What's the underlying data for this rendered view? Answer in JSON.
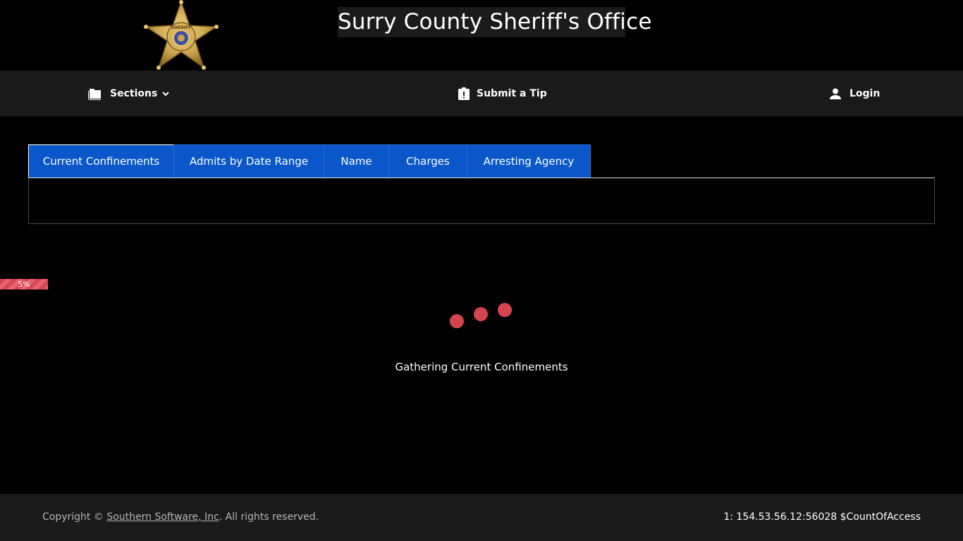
{
  "header": {
    "title": "Surry County Sheriff's Office",
    "badge_text": "SHERIFF",
    "badge_color": "#c9a14a"
  },
  "nav": {
    "sections": {
      "label": "Sections",
      "icon": "folder-icon",
      "caret": "chevron-down-icon"
    },
    "tip": {
      "label": "Submit a Tip",
      "icon": "clipboard-alert-icon"
    },
    "login": {
      "label": "Login",
      "icon": "person-icon"
    }
  },
  "tabs": [
    {
      "label": "Current Confinements",
      "active": true
    },
    {
      "label": "Admits by Date Range",
      "active": false
    },
    {
      "label": "Name",
      "active": false
    },
    {
      "label": "Charges",
      "active": false
    },
    {
      "label": "Arresting Agency",
      "active": false
    }
  ],
  "loading": {
    "progress_label": "5%",
    "progress_value": 0.05,
    "message": "Gathering Current Confinements",
    "dot_color": "#d4454f"
  },
  "footer": {
    "copyright_prefix": "Copyright © ",
    "company_link": "Southern Software, Inc",
    "copyright_suffix": ". All rights reserved.",
    "access_info": "1: 154.53.56.12:56028 $CountOfAccess"
  },
  "colors": {
    "background": "#000000",
    "nav_background": "#1a1a1a",
    "tab_blue": "#0a57c9"
  }
}
